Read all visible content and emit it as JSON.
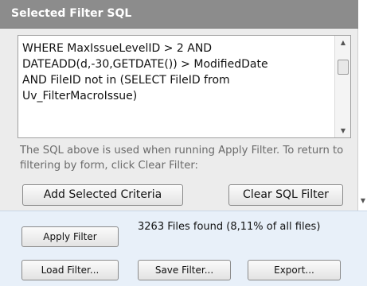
{
  "header": {
    "title": "Selected Filter SQL"
  },
  "sql_editor": {
    "text": "WHERE MaxIssueLevelID > 2 AND\nDATEADD(d,-30,GETDATE()) > ModifiedDate\nAND FileID not in (SELECT FileID from\nUv_FilterMacroIssue)"
  },
  "help_text": "The SQL above is used when running Apply Filter. To return to filtering by form, click Clear Filter:",
  "buttons": {
    "add_selected_criteria": "Add Selected Criteria",
    "clear_sql_filter": "Clear SQL Filter",
    "apply_filter": "Apply Filter",
    "load_filter": "Load Filter...",
    "save_filter": "Save Filter...",
    "export": "Export..."
  },
  "status": {
    "files_found": "3263 Files found (8,11% of all files)"
  }
}
